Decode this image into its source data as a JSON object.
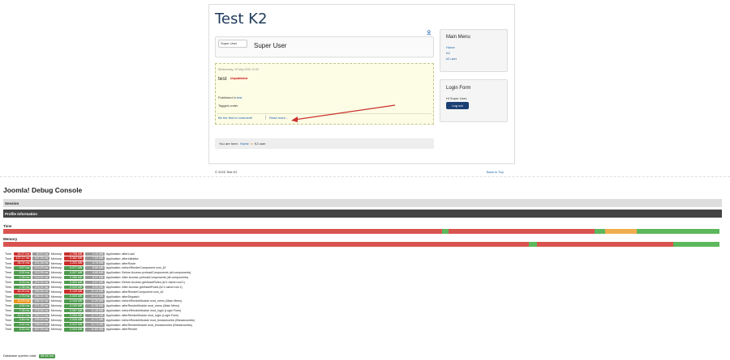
{
  "site": {
    "title": "Test K2",
    "user_chip": "Super User",
    "user_name": "Super User",
    "item": {
      "date": "Wednesday, 20 May 2020 12:00",
      "title": "test",
      "status": "Unpublished",
      "published_label": "Published in",
      "published_link": "test",
      "tagged_label": "Tagged under",
      "comment_link": "Be the first to comment!",
      "readmore_link": "Read more..."
    },
    "breadcrumb": {
      "label": "You are here:",
      "home": "Home",
      "current": "K2 user"
    },
    "main_menu": {
      "title": "Main Menu",
      "items": [
        "Home",
        "K2",
        "k2 user"
      ]
    },
    "login_form": {
      "title": "Login Form",
      "greeting": "Hi Super User,",
      "button": "Log out"
    },
    "footer": {
      "copyright": "© 2020 Test K2",
      "back_to_top": "Back to Top"
    }
  },
  "debug": {
    "title": "Joomla! Debug Console",
    "session_label": "Session",
    "profile_label": "Profile Information",
    "time_label": "Time",
    "memory_label": "Memory",
    "time_bar": [
      {
        "color": "red",
        "pct": 61.3
      },
      {
        "color": "green",
        "pct": 0.9
      },
      {
        "color": "red",
        "pct": 20.4
      },
      {
        "color": "green",
        "pct": 1.4
      },
      {
        "color": "orange",
        "pct": 4.5
      },
      {
        "color": "green",
        "pct": 11.5
      }
    ],
    "memory_bar": [
      {
        "color": "red",
        "pct": 73.4
      },
      {
        "color": "green",
        "pct": 1.1
      },
      {
        "color": "red",
        "pct": 19.1
      },
      {
        "color": "green",
        "pct": 6.4
      }
    ],
    "rows": [
      {
        "t1": "40.27 ms",
        "c1": "r",
        "t2": "40.27 ms",
        "m1": "1.798 MB",
        "cm": "r",
        "m2": "2.10 MB",
        "ev": "Application: afterLoad"
      },
      {
        "t1": "127.17 ms",
        "c1": "r",
        "t2": "167.33 ms",
        "m1": "5.362 MB",
        "cm": "r",
        "m2": "7.53 MB",
        "ev": "Application: afterInitialise"
      },
      {
        "t1": "44.01 ms",
        "c1": "r",
        "t2": "211.36 ms",
        "m1": "1.251 MB",
        "cm": "r",
        "m2": "8.78 MB",
        "ev": "Application: afterRoute"
      },
      {
        "t1": "0.67 ms",
        "c1": "g",
        "t2": "212.03 ms",
        "m1": "0.077 MB",
        "cm": "g",
        "m2": "8.86 MB",
        "ev": "Application: beforeRenderComponent com_k2"
      },
      {
        "t1": "0.92 ms",
        "c1": "g",
        "t2": "212.95 ms",
        "m1": "0.027 MB",
        "cm": "g",
        "m2": "8.88 MB",
        "ev": "Application: Before Access::preloadComponents (all components)"
      },
      {
        "t1": "1.06 ms",
        "c1": "g",
        "t2": "214.01 ms",
        "m1": "0.086 MB",
        "cm": "g",
        "m2": "8.97 MB",
        "ev": "Application: After Access::preloadComponents (all components)"
      },
      {
        "t1": "0.03 ms",
        "c1": "g",
        "t2": "214.04 ms",
        "m1": "0.000 MB",
        "cm": "g",
        "m2": "8.97 MB",
        "ev": "Application: Before Access::getAssetRules (id:1 name:root.1)"
      },
      {
        "t1": "1.28 ms",
        "c1": "g",
        "t2": "215.31 ms",
        "m1": "0.025 MB",
        "cm": "g",
        "m2": "8.99 MB",
        "ev": "Application: After Access::getAssetRules (id:1 name:root.1)"
      },
      {
        "t1": "40.25 ms",
        "c1": "r",
        "t2": "255.56 ms",
        "m1": "2.149 MB",
        "cm": "r",
        "m2": "11.14 MB",
        "ev": "Application: afterRenderComponent com_k2"
      },
      {
        "t1": "0.75 ms",
        "c1": "g",
        "t2": "256.31 ms",
        "m1": "0.000 MB",
        "cm": "g",
        "m2": "11.14 MB",
        "ev": "Application: afterDispatch"
      },
      {
        "t1": "10.03 ms",
        "c1": "o",
        "t2": "266.34 ms",
        "m1": "0.144 MB",
        "cm": "g",
        "m2": "11.28 MB",
        "ev": "Application: beforeRenderModule mod_menu (Main Menu)"
      },
      {
        "t1": "4.94 ms",
        "c1": "g",
        "t2": "271.28 ms",
        "m1": "0.100 MB",
        "cm": "g",
        "m2": "11.38 MB",
        "ev": "Application: afterRenderModule mod_menu (Main Menu)"
      },
      {
        "t1": "7.38 ms",
        "c1": "g",
        "t2": "278.66 ms",
        "m1": "0.067 MB",
        "cm": "g",
        "m2": "11.45 MB",
        "ev": "Application: beforeRenderModule mod_login (Login Form)"
      },
      {
        "t1": "13.47 ms",
        "c1": "g",
        "t2": "292.13 ms",
        "m1": "0.259 MB",
        "cm": "g",
        "m2": "11.71 MB",
        "ev": "Application: afterRenderModule mod_login (Login Form)"
      },
      {
        "t1": "3.46 ms",
        "c1": "g",
        "t2": "295.59 ms",
        "m1": "0.006 MB",
        "cm": "g",
        "m2": "11.71 MB",
        "ev": "Application: beforeRenderModule mod_breadcrumbs (Breadcrumbs)"
      },
      {
        "t1": "2.44 ms",
        "c1": "g",
        "t2": "298.03 ms",
        "m1": "0.022 MB",
        "cm": "g",
        "m2": "11.74 MB",
        "ev": "Application: afterRenderModule mod_breadcrumbs (Breadcrumbs)"
      },
      {
        "t1": "9.32 ms",
        "c1": "g",
        "t2": "307.35 ms",
        "m1": "0.094 MB",
        "cm": "g",
        "m2": "11.83 MB",
        "ev": "Application: afterRender"
      }
    ],
    "db_total_label": "Database queries total:",
    "db_total_value": "36.64 ms"
  }
}
